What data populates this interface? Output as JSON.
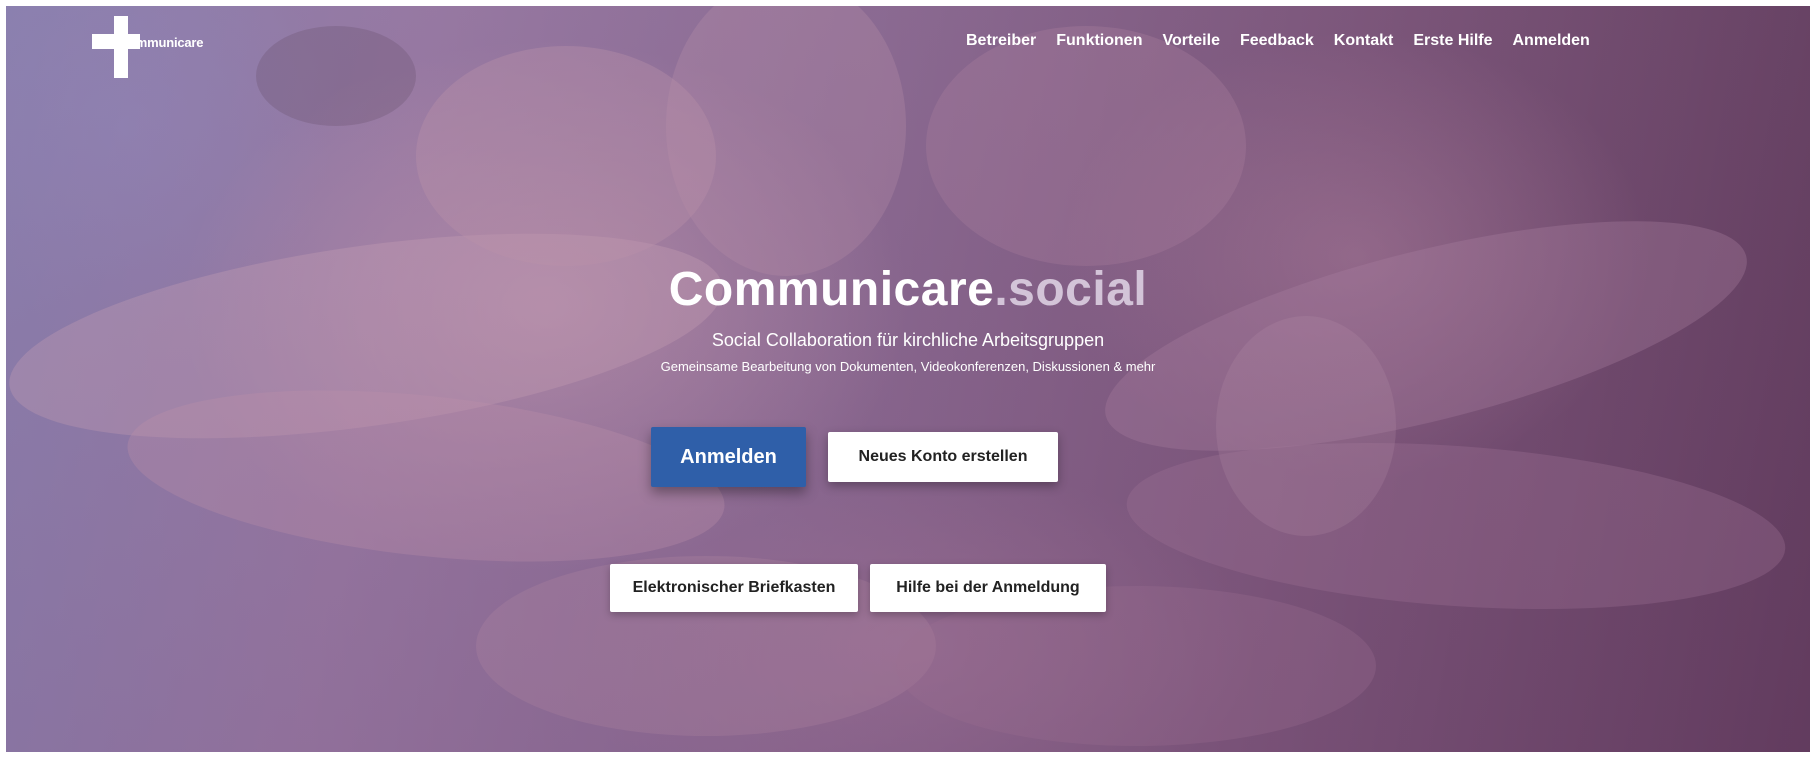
{
  "header": {
    "logo_text": "ommunicare",
    "nav": [
      {
        "label": "Betreiber"
      },
      {
        "label": "Funktionen"
      },
      {
        "label": "Vorteile"
      },
      {
        "label": "Feedback"
      },
      {
        "label": "Kontakt"
      },
      {
        "label": "Erste Hilfe"
      },
      {
        "label": "Anmelden"
      }
    ]
  },
  "hero": {
    "title_main": "Communicare",
    "title_suffix": ".social",
    "subtitle": "Social Collaboration für kirchliche Arbeitsgruppen",
    "tagline": "Gemeinsame Bearbeitung von Dokumenten, Videokonferenzen, Diskussionen & mehr",
    "buttons": {
      "login": "Anmelden",
      "create_account": "Neues Konto erstellen",
      "mailbox": "Elektronischer Briefkasten",
      "login_help": "Hilfe bei der Anmeldung"
    }
  },
  "colors": {
    "primary_button": "#2f5fa9",
    "title_suffix": "#d3c4d8",
    "text": "#ffffff"
  }
}
